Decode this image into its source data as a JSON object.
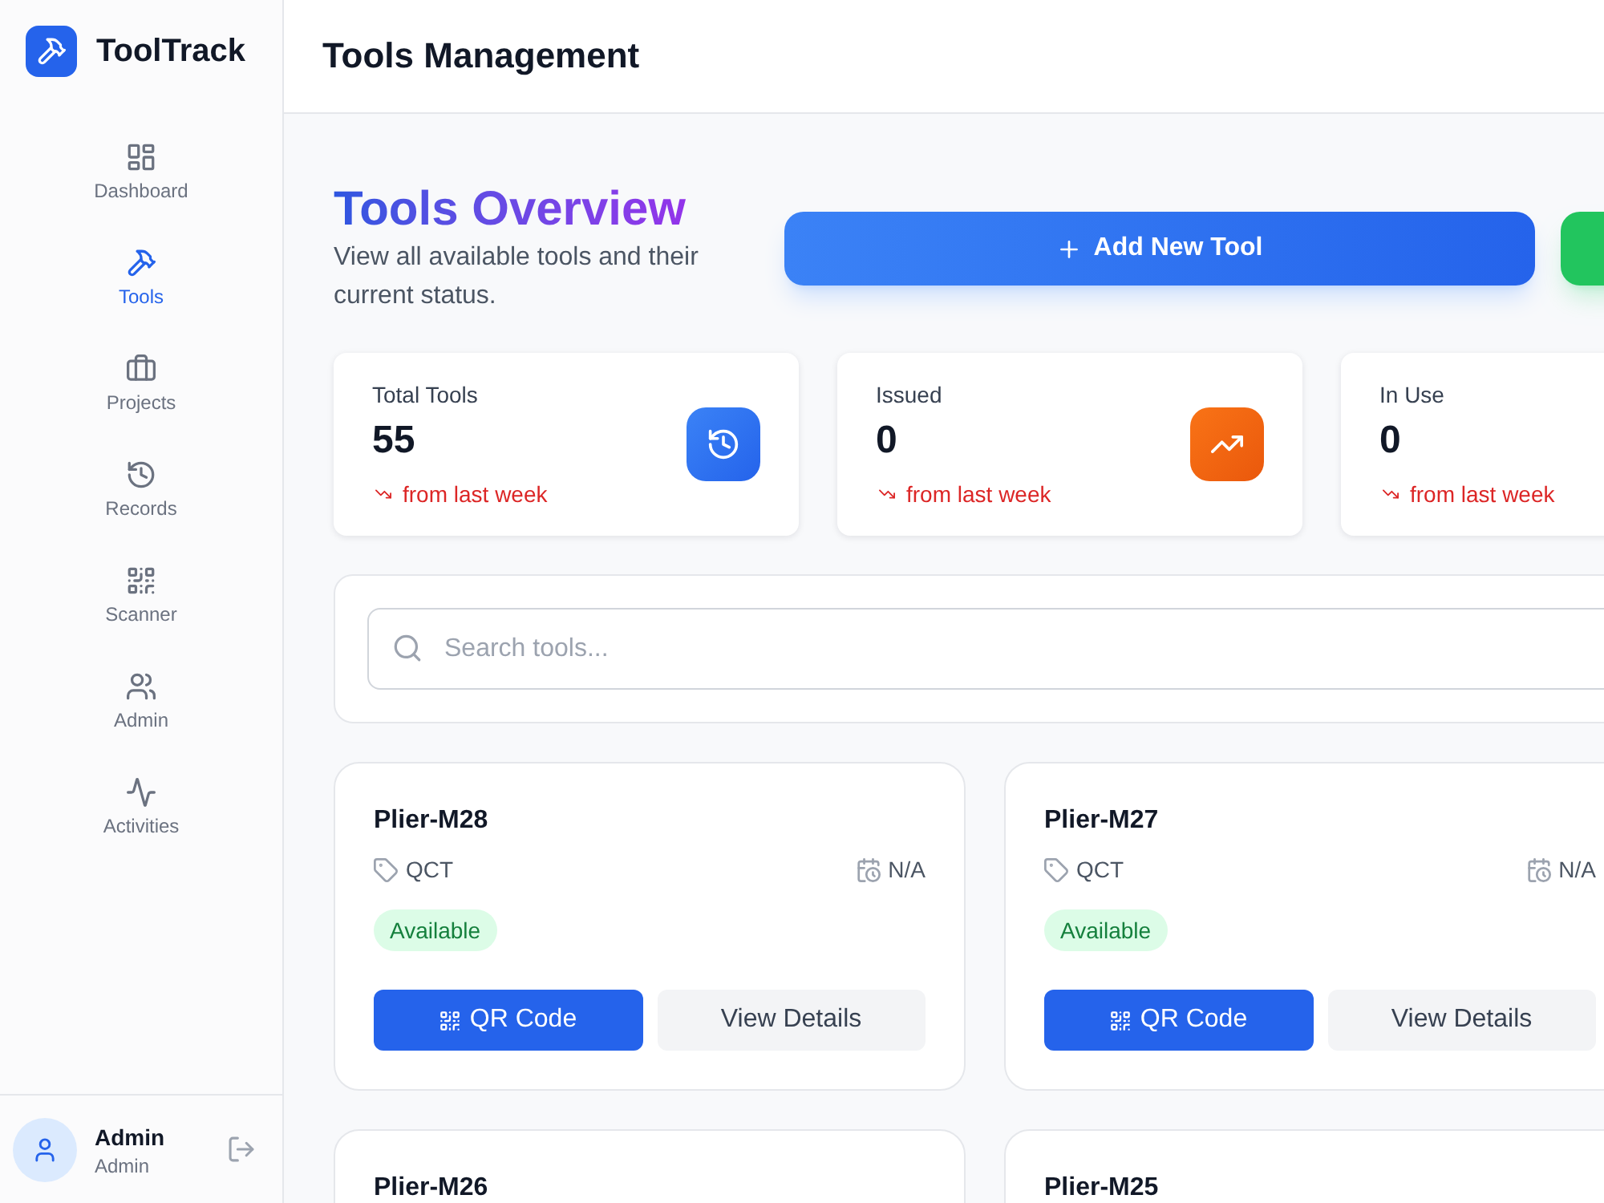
{
  "sidebar": {
    "app_name": "ToolTrack",
    "items": [
      {
        "label": "Dashboard",
        "kind": "dashboard",
        "selected": false
      },
      {
        "label": "Tools",
        "kind": "tools",
        "selected": true
      },
      {
        "label": "Projects",
        "kind": "projects",
        "selected": false
      },
      {
        "label": "Records",
        "kind": "records",
        "selected": false
      },
      {
        "label": "Scanner",
        "kind": "scanner",
        "selected": false
      },
      {
        "label": "Admin",
        "kind": "admin",
        "selected": false
      },
      {
        "label": "Activities",
        "kind": "activities",
        "selected": false
      }
    ],
    "user": {
      "name": "Admin",
      "role": "Admin"
    }
  },
  "header": {
    "title": "Tools Management"
  },
  "overview": {
    "title": "Tools Overview",
    "subtitle": "View all available tools and their current status.",
    "actions": [
      {
        "kind": "primary",
        "label": "Add New Tool"
      },
      {
        "kind": "success"
      }
    ]
  },
  "stats": [
    {
      "kind": "total",
      "label": "Total Tools",
      "value": "55",
      "falling": true,
      "trend": "from last week"
    },
    {
      "kind": "issued",
      "label": "Issued",
      "value": "0",
      "falling": true,
      "trend": "from last week"
    },
    {
      "kind": "in_use",
      "label": "In Use",
      "value": "0",
      "falling": true,
      "trend": "from last week"
    }
  ],
  "search": {
    "placeholder": "Search tools..."
  },
  "tools": [
    {
      "name": "Plier-M28",
      "category": "QCT",
      "due": "N/A",
      "status": "Available",
      "available": true,
      "actions": [
        {
          "kind": "qr",
          "label": "QR Code"
        },
        {
          "kind": "details",
          "label": "View Details"
        }
      ]
    },
    {
      "name": "Plier-M27",
      "category": "QCT",
      "due": "N/A",
      "status": "Available",
      "available": true,
      "actions": [
        {
          "kind": "qr",
          "label": "QR Code"
        },
        {
          "kind": "details",
          "label": "View Details"
        }
      ]
    },
    {
      "name": "Plier-M26"
    },
    {
      "name": "Plier-M25"
    }
  ]
}
